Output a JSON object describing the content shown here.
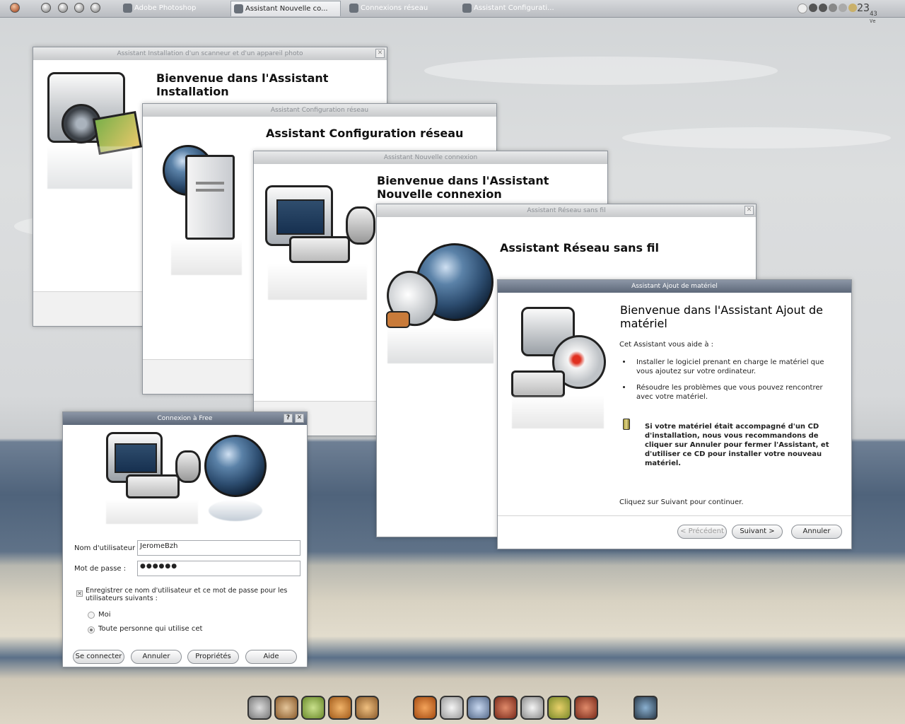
{
  "taskbar": {
    "tasks": [
      {
        "label": "Adobe Photoshop"
      },
      {
        "label": "Assistant Nouvelle co..."
      },
      {
        "label": "Connexions réseau"
      },
      {
        "label": "Assistant Configurati..."
      }
    ],
    "clock": {
      "hours": "23",
      "minutes": "43",
      "day": "Ve"
    }
  },
  "win_scanner": {
    "title": "Assistant Installation d'un scanneur et d'un appareil photo",
    "heading": "Bienvenue dans l'Assistant Installation"
  },
  "win_config": {
    "title": "Assistant Configuration réseau",
    "heading": "Assistant Configuration réseau"
  },
  "win_nouvelle": {
    "title": "Assistant Nouvelle connexion",
    "heading": "Bienvenue dans l'Assistant Nouvelle connexion"
  },
  "win_sansfil": {
    "title": "Assistant Réseau sans fil",
    "heading": "Assistant Réseau sans fil"
  },
  "win_ajout": {
    "title": "Assistant Ajout de matériel",
    "heading": "Bienvenue dans l'Assistant Ajout de matériel",
    "intro": "Cet Assistant vous aide à :",
    "bullet1": "Installer le logiciel prenant en charge le matériel que vous ajoutez sur votre ordinateur.",
    "bullet2": "Résoudre les problèmes que vous pouvez rencontrer avec votre matériel.",
    "cd_note": "Si votre matériel était accompagné d'un CD d'installation, nous vous recommandons de cliquer sur Annuler pour fermer l'Assistant, et d'utiliser ce CD pour installer votre nouveau matériel.",
    "continue": "Cliquez sur Suivant pour continuer.",
    "btn_prev": "< Précédent",
    "btn_next": "Suivant >",
    "btn_cancel": "Annuler"
  },
  "win_free": {
    "title": "Connexion à Free",
    "help_btn": "?",
    "close_btn": "✕",
    "user_label": "Nom d'utilisateur :",
    "user_value": "JeromeBzh",
    "pass_label": "Mot de passe :",
    "pass_value": "●●●●●●",
    "save_label": "Enregistrer ce nom d'utilisateur et ce mot de passe pour les utilisateurs suivants :",
    "radio_me": "Moi",
    "radio_all": "Toute personne qui utilise cet",
    "btn_connect": "Se connecter",
    "btn_cancel": "Annuler",
    "btn_props": "Propriétés",
    "btn_help": "Aide"
  },
  "colors": {
    "titlebar_active": "#5d6879",
    "titlebar_inactive": "#c7c9cb",
    "sea": "#4f637b",
    "sand": "#e2dccd"
  }
}
